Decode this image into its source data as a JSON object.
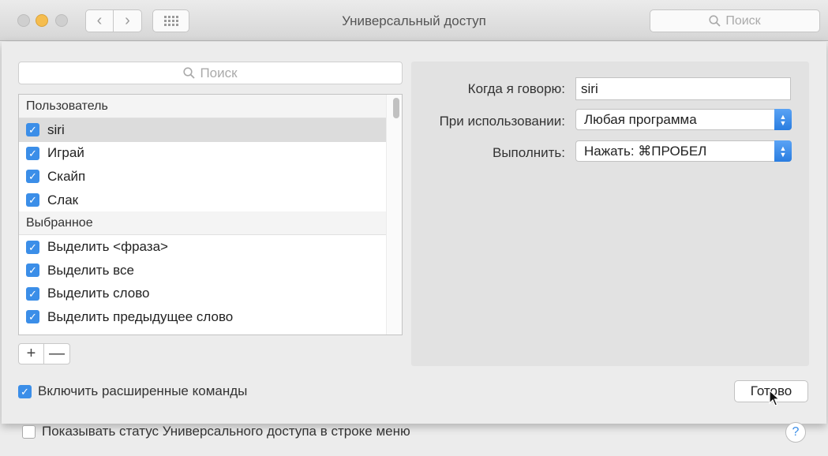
{
  "window": {
    "title": "Универсальный доступ",
    "search_placeholder": "Поиск"
  },
  "sheet": {
    "list_search_placeholder": "Поиск",
    "groups": [
      {
        "header": "Пользователь",
        "items": [
          {
            "label": "siri",
            "checked": true,
            "selected": true
          },
          {
            "label": "Играй",
            "checked": true
          },
          {
            "label": "Скайп",
            "checked": true
          },
          {
            "label": "Слак",
            "checked": true
          }
        ]
      },
      {
        "header": "Выбранное",
        "items": [
          {
            "label": "Выделить <фраза>",
            "checked": true
          },
          {
            "label": "Выделить все",
            "checked": true
          },
          {
            "label": "Выделить слово",
            "checked": true
          },
          {
            "label": "Выделить предыдущее слово",
            "checked": true
          }
        ]
      }
    ],
    "add_label": "+",
    "remove_label": "—",
    "detail": {
      "when_label": "Когда я говорю:",
      "when_value": "siri",
      "while_label": "При использовании:",
      "while_value": "Любая программа",
      "perform_label": "Выполнить:",
      "perform_value": "Нажать: ⌘ПРОБЕЛ"
    },
    "advanced_label": "Включить расширенные команды",
    "done_label": "Готово"
  },
  "bottom": {
    "status_label": "Показывать статус Универсального доступа в строке меню",
    "help_label": "?"
  },
  "icons": {
    "search": "search-icon",
    "check": "checkmark-icon"
  },
  "colors": {
    "accent": "#3b8ee8"
  }
}
